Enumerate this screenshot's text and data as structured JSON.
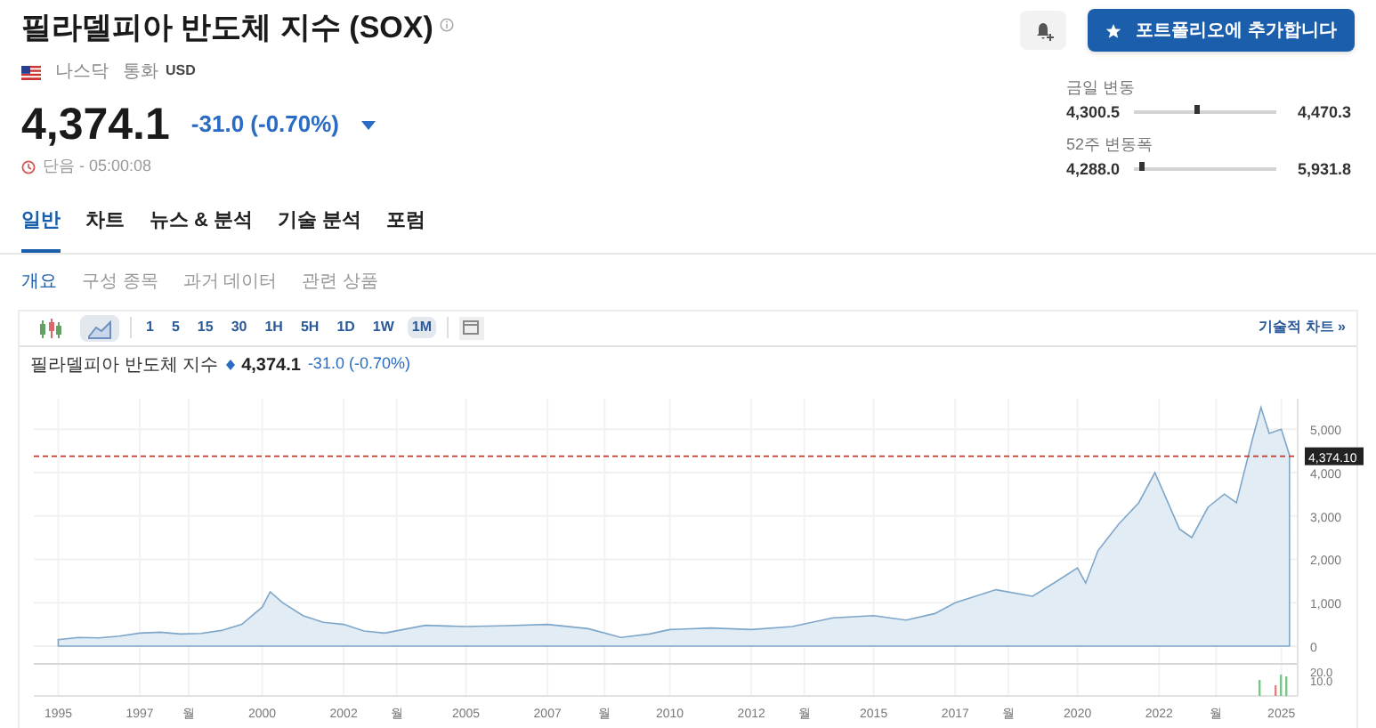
{
  "title": "필라델피아 반도체 지수 (SOX)",
  "meta": {
    "exchange": "나스닥",
    "currency_label": "통화",
    "currency": "USD"
  },
  "quote": {
    "price": "4,374.1",
    "change": "-31.0 (-0.70%)",
    "falling": true,
    "status": "단음 - 05:00:08"
  },
  "portfolio_button": "포트폴리오에 추가합니다",
  "ranges": [
    {
      "label": "금일 변동",
      "low": "4,300.5",
      "high": "4,470.3",
      "level": 0.44
    },
    {
      "label": "52주 변동폭",
      "low": "4,288.0",
      "high": "5,931.8",
      "level": 0.05
    }
  ],
  "tabs": [
    {
      "label": "일반",
      "selected": true
    },
    {
      "label": "차트",
      "selected": false
    },
    {
      "label": "뉴스 & 분석",
      "selected": false
    },
    {
      "label": "기술 분석",
      "selected": false
    },
    {
      "label": "포럼",
      "selected": false
    }
  ],
  "subtabs": [
    {
      "label": "개요",
      "selected": true
    },
    {
      "label": "구성 종목",
      "selected": false
    },
    {
      "label": "과거 데이터",
      "selected": false
    },
    {
      "label": "관련 상품",
      "selected": false
    }
  ],
  "chart_types": [
    {
      "kind": "candles",
      "selected": false
    },
    {
      "kind": "area",
      "selected": true
    }
  ],
  "timeframes": [
    {
      "label": "1",
      "selected": false
    },
    {
      "label": "5",
      "selected": false
    },
    {
      "label": "15",
      "selected": false
    },
    {
      "label": "30",
      "selected": false
    },
    {
      "label": "1H",
      "selected": false
    },
    {
      "label": "5H",
      "selected": false
    },
    {
      "label": "1D",
      "selected": false
    },
    {
      "label": "1W",
      "selected": false
    },
    {
      "label": "1M",
      "selected": true
    }
  ],
  "technical_link": "기술적 차트 »",
  "chart_header": {
    "price": "4,374.1",
    "change": "-31.0 (-0.70%)"
  },
  "chart": {
    "chart_data": {
      "type": "area",
      "x": [
        1995,
        1995.5,
        1996,
        1996.5,
        1997,
        1997.5,
        1998,
        1998.5,
        1999,
        1999.5,
        2000,
        2000.2,
        2000.5,
        2001,
        2001.5,
        2002,
        2002.5,
        2003,
        2004,
        2005,
        2006,
        2007,
        2008,
        2008.8,
        2009.5,
        2010,
        2011,
        2012,
        2013,
        2014,
        2015,
        2015.8,
        2016.5,
        2017,
        2018,
        2018.9,
        2019.5,
        2020,
        2020.2,
        2020.5,
        2021,
        2021.5,
        2021.9,
        2022.5,
        2022.8,
        2023.2,
        2023.6,
        2023.9,
        2024.3,
        2024.5,
        2024.7,
        2025,
        2025.2
      ],
      "series": [
        {
          "name": "필라델피아 반도체 지수",
          "color": "#7ea6c9",
          "values": [
            150,
            200,
            190,
            230,
            300,
            320,
            280,
            290,
            360,
            500,
            900,
            1250,
            1000,
            700,
            550,
            500,
            350,
            300,
            480,
            450,
            470,
            500,
            400,
            200,
            280,
            380,
            420,
            380,
            450,
            650,
            700,
            600,
            750,
            1000,
            1300,
            1150,
            1500,
            1800,
            1450,
            2200,
            2800,
            3300,
            4000,
            2700,
            2500,
            3200,
            3500,
            3300,
            4800,
            5500,
            4900,
            5000,
            4400
          ]
        }
      ],
      "xlim": [
        1994.4,
        2025.4
      ],
      "ylim": [
        0,
        5700
      ],
      "grid": true,
      "yticks": [
        {
          "value": 0,
          "label": "0"
        },
        {
          "value": 1000,
          "label": "1,000"
        },
        {
          "value": 2000,
          "label": "2,000"
        },
        {
          "value": 3000,
          "label": "3,000"
        },
        {
          "value": 4000,
          "label": "4,000"
        },
        {
          "value": 5000,
          "label": "5,000"
        }
      ],
      "xticks": [
        {
          "value": 1995,
          "label": "1995"
        },
        {
          "value": 1997,
          "label": "1997"
        },
        {
          "value": 1998.2,
          "label": "월"
        },
        {
          "value": 2000,
          "label": "2000"
        },
        {
          "value": 2002,
          "label": "2002"
        },
        {
          "value": 2003.3,
          "label": "월"
        },
        {
          "value": 2005,
          "label": "2005"
        },
        {
          "value": 2007,
          "label": "2007"
        },
        {
          "value": 2008.4,
          "label": "월"
        },
        {
          "value": 2010,
          "label": "2010"
        },
        {
          "value": 2012,
          "label": "2012"
        },
        {
          "value": 2013.3,
          "label": "월"
        },
        {
          "value": 2015,
          "label": "2015"
        },
        {
          "value": 2017,
          "label": "2017"
        },
        {
          "value": 2018.3,
          "label": "월"
        },
        {
          "value": 2020,
          "label": "2020"
        },
        {
          "value": 2022,
          "label": "2022"
        },
        {
          "value": 2023.4,
          "label": "월"
        },
        {
          "value": 2025,
          "label": "2025"
        }
      ],
      "ref_lines": [
        {
          "axis": "y",
          "value": 4374.1,
          "label": "4,374.10",
          "color": "#c0392b"
        }
      ]
    },
    "volume_ticks": [
      "20.0",
      "10.0"
    ]
  }
}
